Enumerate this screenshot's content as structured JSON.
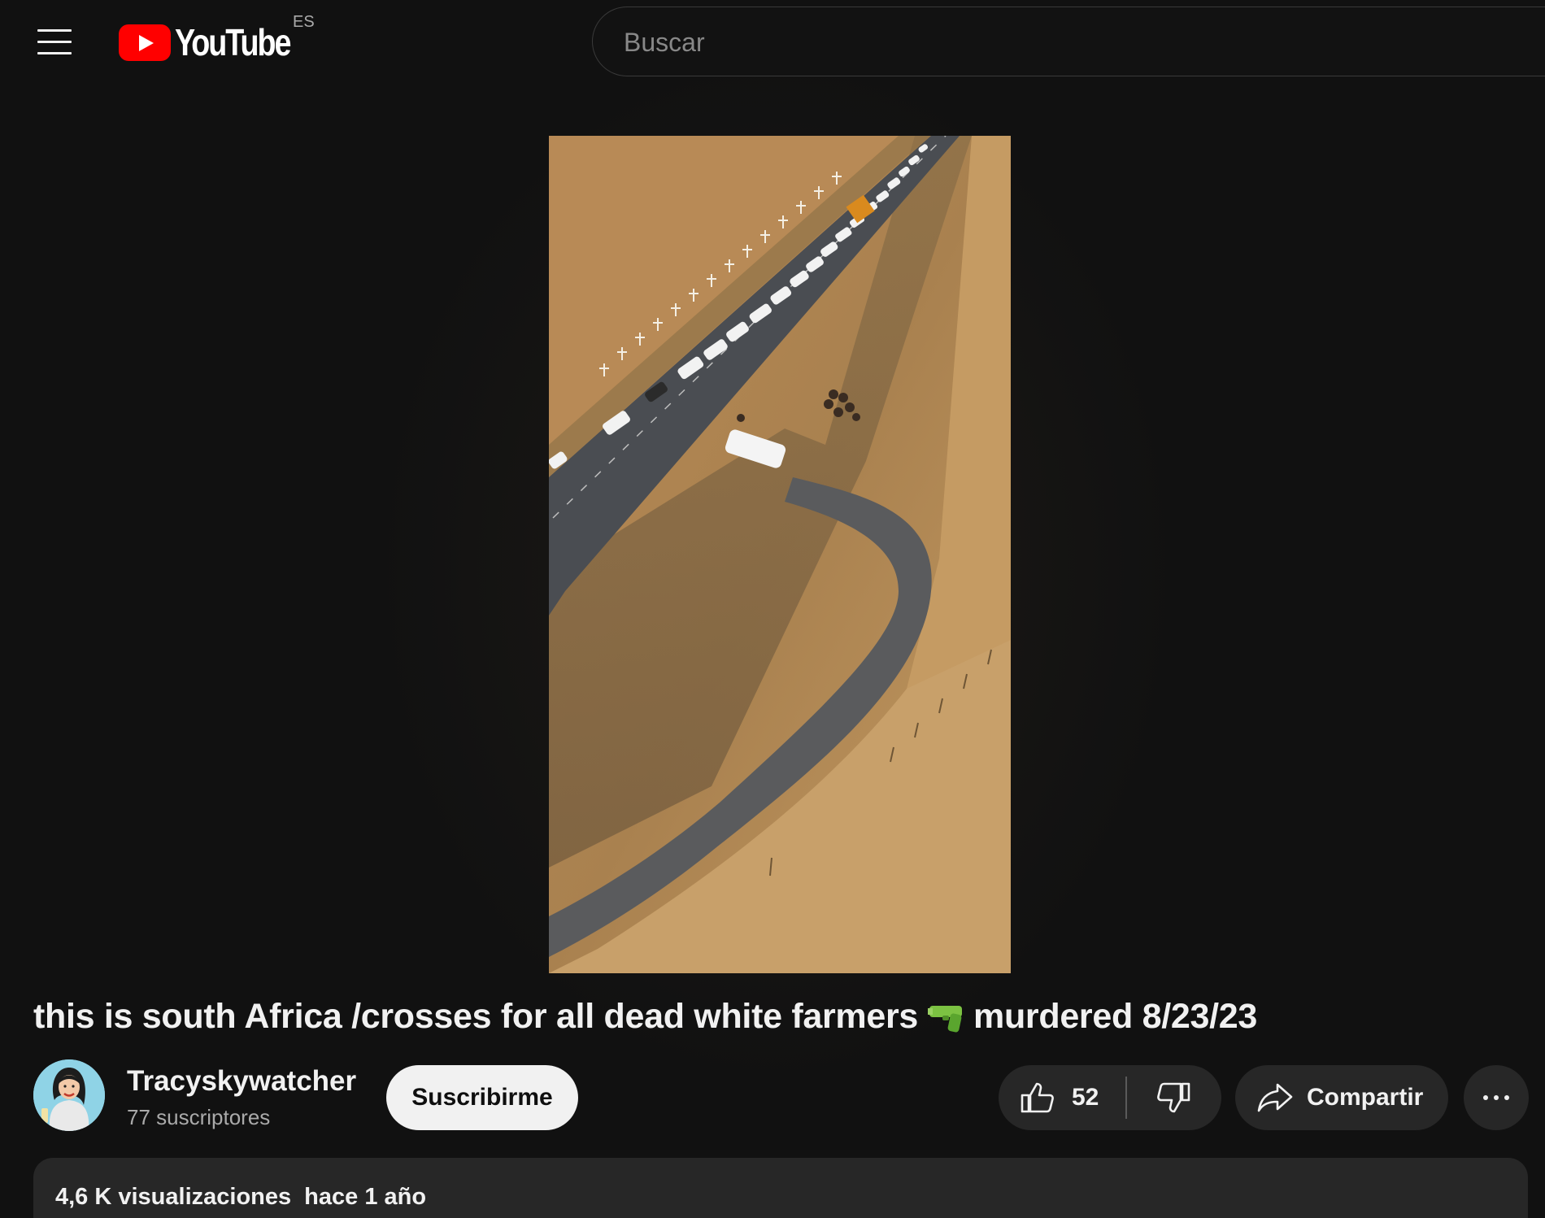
{
  "masthead": {
    "logo_text": "YouTube",
    "country_code": "ES",
    "search_placeholder": "Buscar"
  },
  "video": {
    "title_before_emoji": "this is south Africa /crosses for all dead white farmers",
    "title_emoji": "water-pistol-emoji",
    "title_after_emoji": "murdered 8/23/23"
  },
  "owner": {
    "channel_name": "Tracyskywatcher",
    "subscriber_count": "77 suscriptores",
    "subscribe_label": "Suscribirme"
  },
  "actions": {
    "like_count": "52",
    "share_label": "Compartir"
  },
  "description": {
    "views": "4,6 K visualizaciones",
    "date": "hace 1 año"
  },
  "colors": {
    "background": "#0f0f0f",
    "button_bg": "#272727",
    "brand_red": "#ff0000",
    "subscribe_bg": "#f1f1f1",
    "text_primary": "#f1f1f1",
    "text_secondary": "#aaaaaa"
  },
  "icons": [
    "menu-icon",
    "youtube-logo-icon",
    "like-icon",
    "dislike-icon",
    "share-icon",
    "more-icon"
  ]
}
